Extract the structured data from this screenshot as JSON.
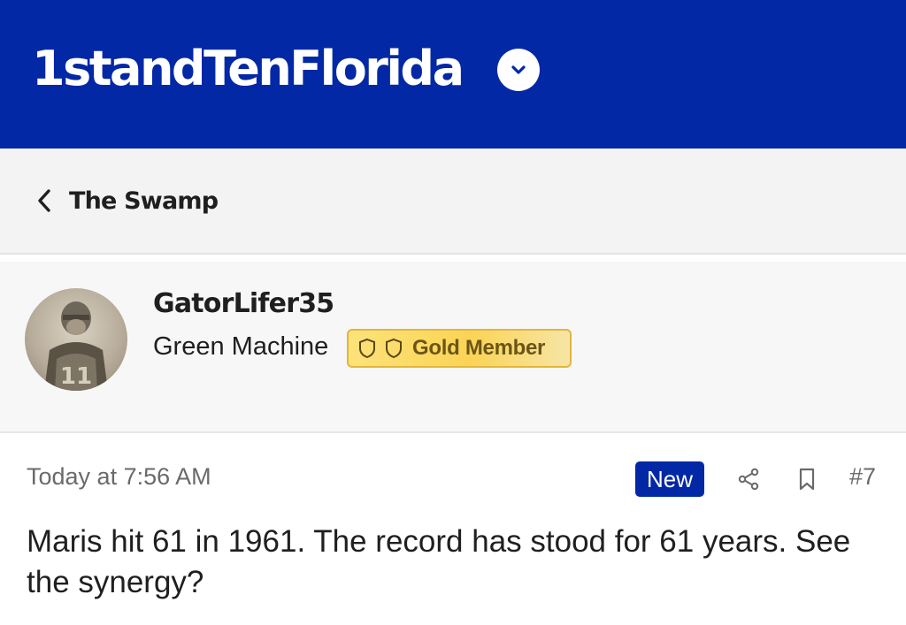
{
  "header": {
    "site_title": "1standTenFlorida",
    "menu_icon": "chevron-down-icon",
    "background_color": "#0228a6"
  },
  "breadcrumb": {
    "back_icon": "chevron-left-icon",
    "label": "The Swamp"
  },
  "user": {
    "username": "GatorLifer35",
    "title": "Green Machine",
    "badge": {
      "icons": [
        "shield-icon",
        "shield-icon"
      ],
      "label": "Gold Member",
      "color": "#fbd455"
    }
  },
  "post": {
    "timestamp": "Today at 7:56 AM",
    "new_badge": "New",
    "share_icon": "share-icon",
    "bookmark_icon": "bookmark-icon",
    "post_number": "#7",
    "body": "Maris hit 61 in 1961. The record has stood for 61 years. See the synergy?"
  }
}
